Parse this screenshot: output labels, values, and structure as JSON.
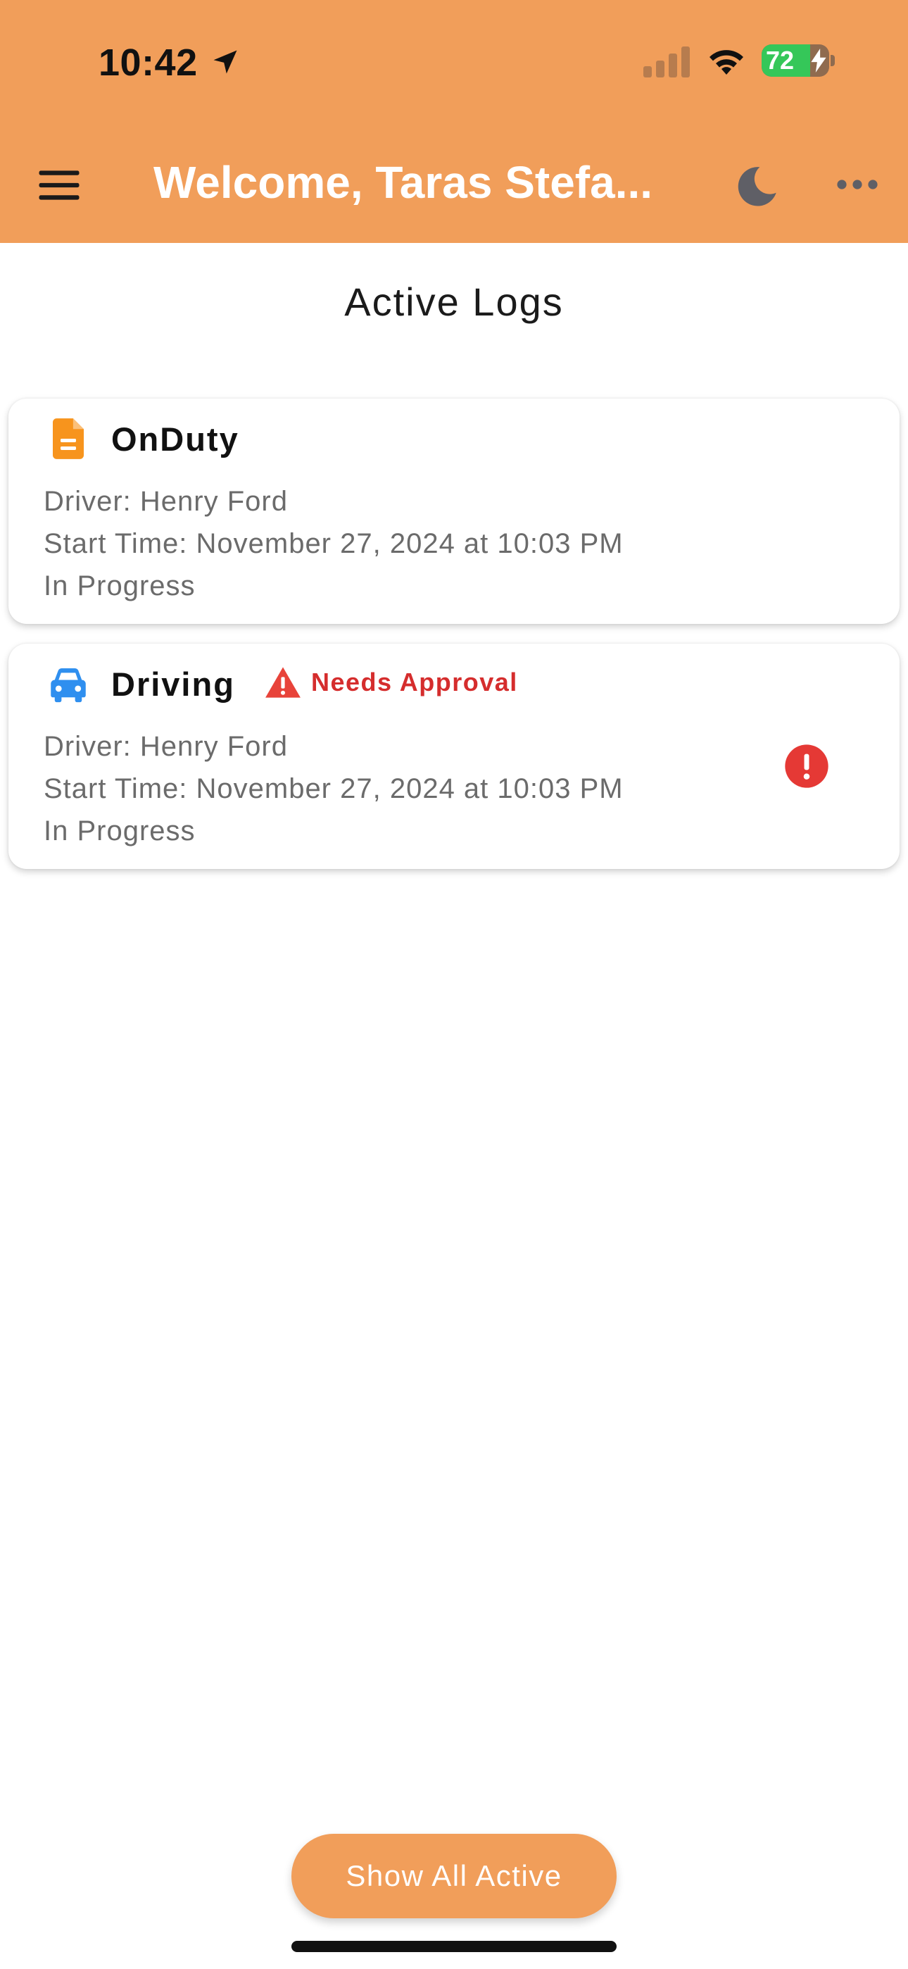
{
  "status_bar": {
    "time": "10:42",
    "battery_level": "72",
    "battery_fraction": 0.72,
    "icons": [
      "location-arrow-icon",
      "cellular-signal-icon",
      "wifi-icon",
      "battery-charging-icon"
    ]
  },
  "header": {
    "title": "Welcome, Taras Stefa...",
    "menu_icon": "hamburger-menu-icon",
    "theme_icon": "moon-icon",
    "more_icon": "ellipsis-icon",
    "background_color": "#F19E5A"
  },
  "page": {
    "title": "Active Logs"
  },
  "logs": [
    {
      "type": "OnDuty",
      "icon": "document-icon",
      "icon_color": "#F7941D",
      "driver": "Driver: Henry Ford",
      "start_time": "Start Time: November 27, 2024 at 10:03 PM",
      "status": "In Progress",
      "needs_approval": false
    },
    {
      "type": "Driving",
      "icon": "car-icon",
      "icon_color": "#2F8FEF",
      "badge_icon": "warning-triangle-icon",
      "badge_text": "Needs Approval",
      "badge_color": "#D52D2D",
      "driver": "Driver: Henry Ford",
      "start_time": "Start Time: November 27, 2024 at 10:03 PM",
      "status": "In Progress",
      "needs_approval": true,
      "alert_icon": "exclamation-circle-icon"
    }
  ],
  "actions": {
    "show_all_label": "Show All Active"
  }
}
